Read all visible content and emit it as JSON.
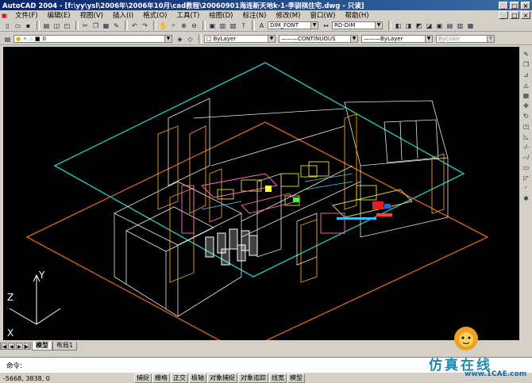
{
  "window": {
    "title": "AutoCAD 2004 - [f:\\yy\\ysl\\2006年\\2006年10月\\cad教程\\20060901海连新天地k-1-李驯祺住宅.dwg - 只读]",
    "minimize": "_",
    "restore": "□",
    "close": "×"
  },
  "menu": {
    "items": [
      "文件(F)",
      "编辑(E)",
      "视图(V)",
      "插入(I)",
      "格式(O)",
      "工具(T)",
      "绘图(D)",
      "标注(N)",
      "修改(M)",
      "窗口(W)",
      "帮助(H)"
    ],
    "doc_min": "_",
    "doc_restore": "□",
    "doc_close": "×"
  },
  "toolbar1": {
    "text_style": "DIM_FONT",
    "dim_style": "RD-DIM"
  },
  "toolbar2": {
    "layer": "0",
    "color": "ByLayer",
    "linetype": "CONTINUOUS",
    "lineweight": "ByLayer",
    "plotstyle": "ByColor"
  },
  "canvas": {
    "ucs_z": "Z",
    "ucs_y": "Y",
    "ucs_x": "X"
  },
  "tabs": {
    "model": "模型",
    "layout1": "布局1"
  },
  "command": {
    "prompt": "命令:"
  },
  "status": {
    "coords": "-5668, 3838, 0",
    "toggles": [
      "捕捉",
      "栅格",
      "正交",
      "极轴",
      "对象捕捉",
      "对象追踪",
      "线宽",
      "模型"
    ]
  },
  "watermark": {
    "text": "仿真在线",
    "url": "www.1CAE.com"
  }
}
